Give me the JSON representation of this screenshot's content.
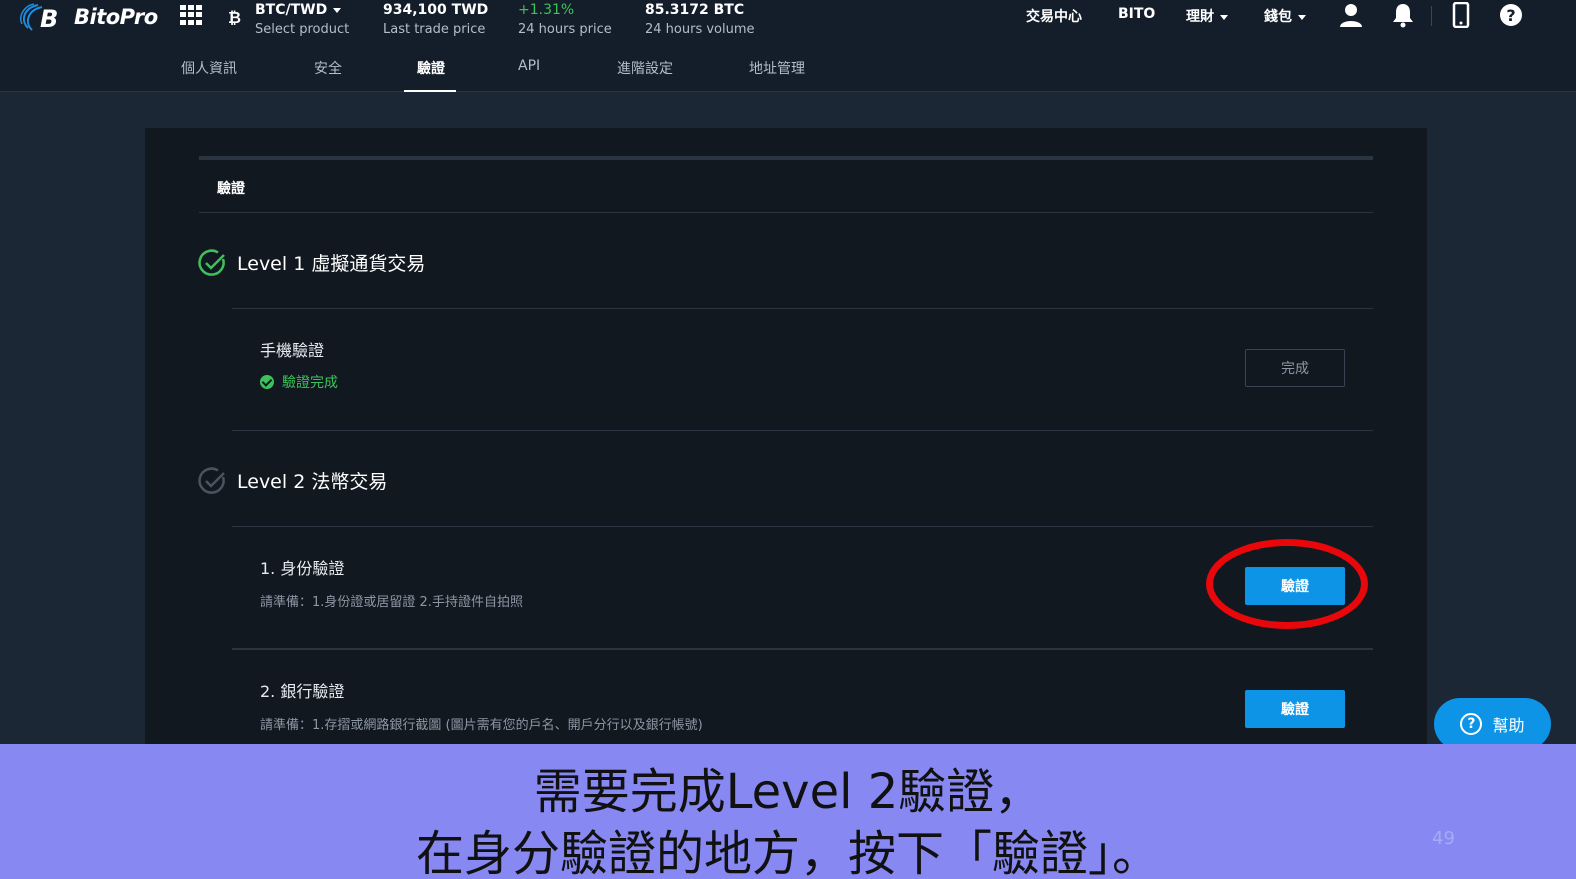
{
  "brand": {
    "name": "BitoPro",
    "logo_icon": "bitopro-logo-icon"
  },
  "ticker": {
    "pair": "BTC/TWD",
    "pair_label": "Select product",
    "last_price": "934,100 TWD",
    "last_price_label": "Last trade price",
    "change": "+1.31%",
    "change_label": "24 hours price",
    "volume": "85.3172 BTC",
    "volume_label": "24 hours volume"
  },
  "topnav": {
    "exchange": "交易中心",
    "bito": "BITO",
    "finance": "理財",
    "wallet": "錢包",
    "icons": [
      "user-icon",
      "bell-icon",
      "mobile-icon",
      "help-circle-icon"
    ]
  },
  "subnav": {
    "items": [
      "個人資訊",
      "安全",
      "驗證",
      "API",
      "進階設定",
      "地址管理"
    ],
    "active": "驗證"
  },
  "panel": {
    "title": "驗證",
    "level1": {
      "title": "Level 1 虛擬通貨交易",
      "item": {
        "title": "手機驗證",
        "status": "驗證完成",
        "button": "完成"
      }
    },
    "level2": {
      "title": "Level 2 法幣交易",
      "items": [
        {
          "title": "1. 身份驗證",
          "note": "請準備：1.身份證或居留證 2.手持證件自拍照",
          "button": "驗證"
        },
        {
          "title": "2. 銀行驗證",
          "note": "請準備：1.存摺或網路銀行截圖 (圖片需有您的戶名、開戶分行以及銀行帳號)",
          "button": "驗證"
        }
      ]
    }
  },
  "help": {
    "label": "幫助"
  },
  "caption": {
    "line1": "需要完成Level 2驗證，",
    "line2": "在身分驗證的地方，按下「驗證」。",
    "slide_number": "49"
  },
  "colors": {
    "accent": "#0d94e6",
    "success": "#3dc25b",
    "highlight": "#e8070b",
    "caption_bg": "#8788f2"
  }
}
